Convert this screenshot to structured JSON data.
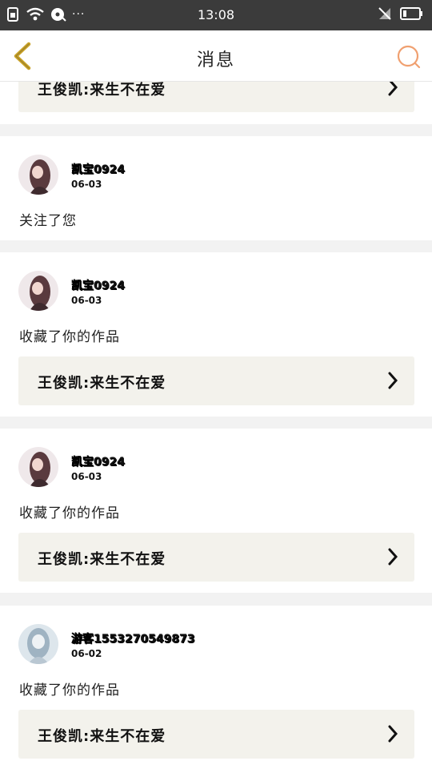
{
  "status_bar": {
    "time": "13:08",
    "dots": "···"
  },
  "header": {
    "title": "消息"
  },
  "items": [
    {
      "work_title": "王俊凯:来生不在爱"
    },
    {
      "username": "凯宝0924",
      "date": "06-03",
      "action": "关注了您"
    },
    {
      "username": "凯宝0924",
      "date": "06-03",
      "action": "收藏了你的作品",
      "work_title": "王俊凯:来生不在爱"
    },
    {
      "username": "凯宝0924",
      "date": "06-03",
      "action": "收藏了你的作品",
      "work_title": "王俊凯:来生不在爱"
    },
    {
      "username": "游客1553270549873",
      "date": "06-02",
      "action": "收藏了你的作品",
      "work_title": "王俊凯:来生不在爱"
    }
  ],
  "colors": {
    "accent_back": "#c9a227",
    "accent_search": "#f0a070",
    "card_work_bg": "#f3f2ec"
  }
}
